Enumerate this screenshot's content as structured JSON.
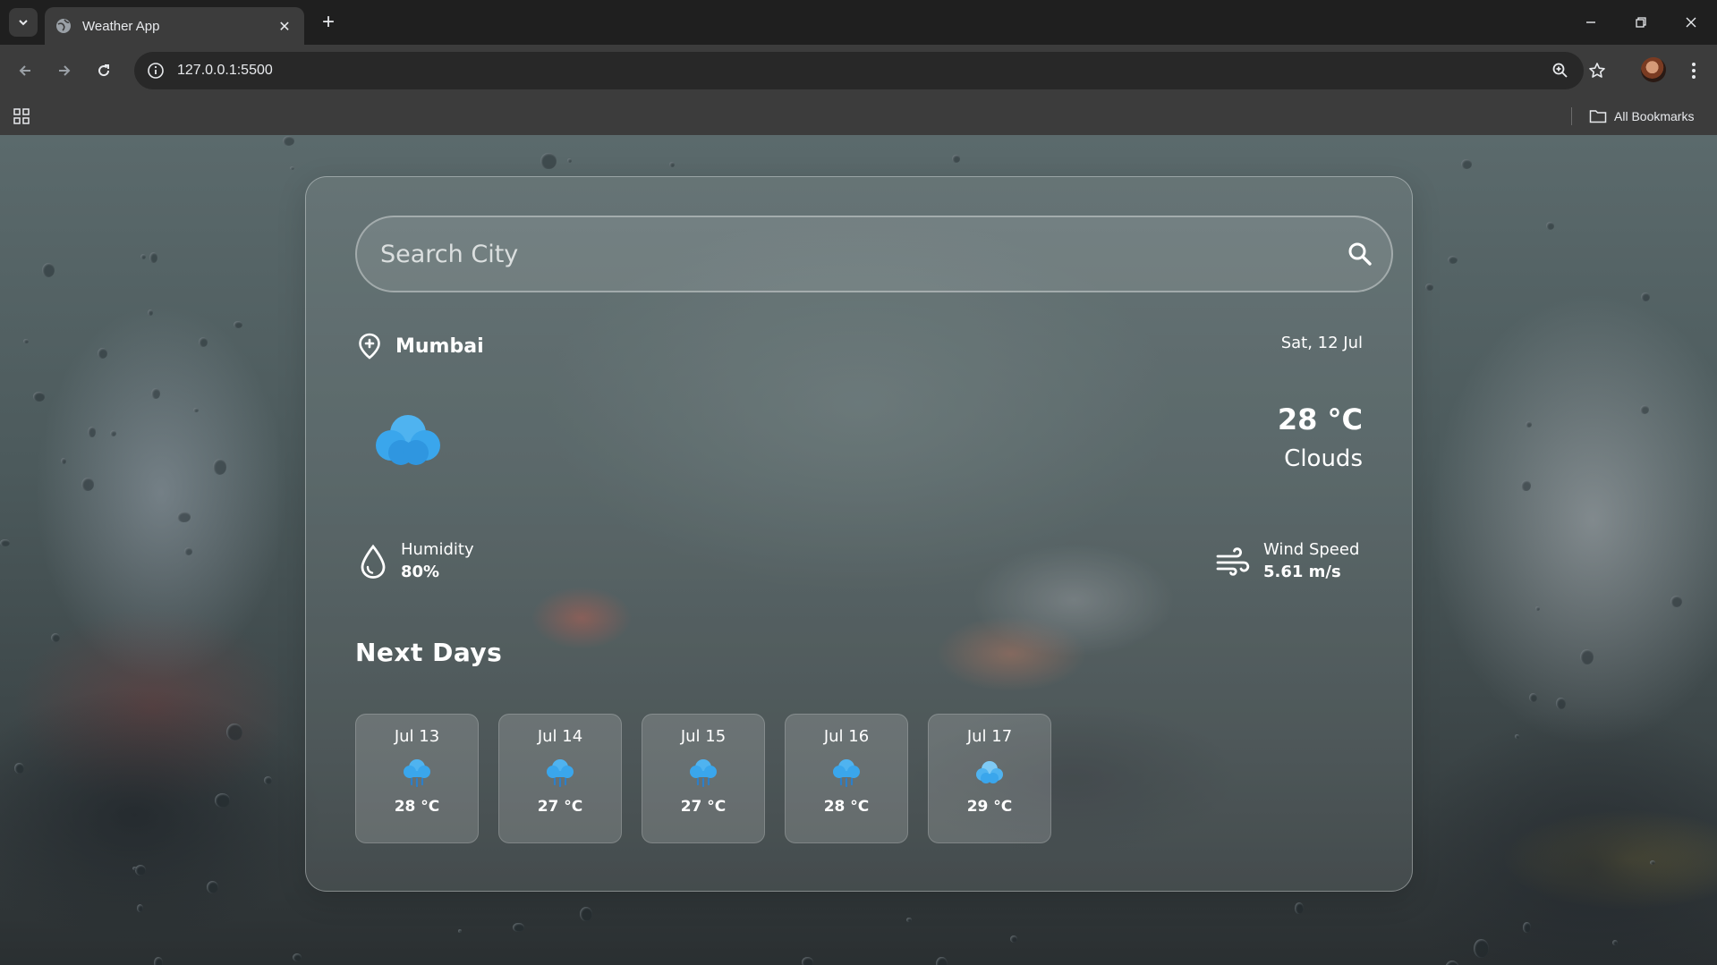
{
  "browser": {
    "tab_title": "Weather App",
    "url": "127.0.0.1:5500",
    "bookmarks_label": "All Bookmarks"
  },
  "search": {
    "placeholder": "Search City"
  },
  "location": {
    "city": "Mumbai",
    "date": "Sat, 12 Jul"
  },
  "current": {
    "temperature": "28 °C",
    "condition": "Clouds",
    "icon": "clouds-icon"
  },
  "stats": {
    "humidity_label": "Humidity",
    "humidity_value": "80%",
    "wind_label": "Wind Speed",
    "wind_value": "5.61 m/s"
  },
  "next_days": {
    "title": "Next Days",
    "items": [
      {
        "date": "Jul 13",
        "icon": "rain-icon",
        "temp": "28 °C"
      },
      {
        "date": "Jul 14",
        "icon": "rain-icon",
        "temp": "27 °C"
      },
      {
        "date": "Jul 15",
        "icon": "rain-icon",
        "temp": "27 °C"
      },
      {
        "date": "Jul 16",
        "icon": "rain-icon",
        "temp": "28 °C"
      },
      {
        "date": "Jul 17",
        "icon": "clouds-icon",
        "temp": "29 °C"
      }
    ]
  },
  "colors": {
    "icon_blue": "#4fb3f0",
    "icon_blue_dark": "#2e8fd6"
  }
}
